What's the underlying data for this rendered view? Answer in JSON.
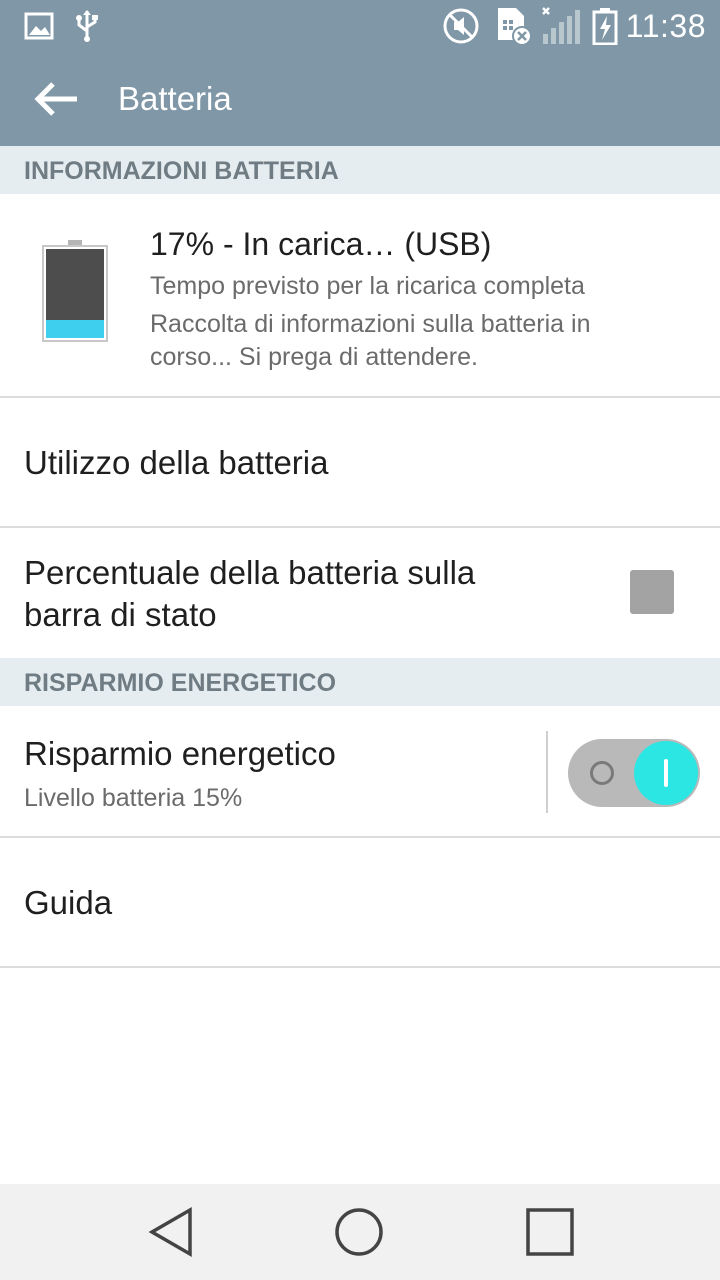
{
  "status_bar": {
    "time": "11:38",
    "icons": [
      "gallery-icon",
      "usb-icon",
      "mute-icon",
      "sim-error-icon",
      "signal-icon",
      "battery-charging-icon"
    ]
  },
  "app_bar": {
    "title": "Batteria"
  },
  "sections": {
    "battery_info_header": "INFORMAZIONI BATTERIA",
    "power_saving_header": "RISPARMIO ENERGETICO"
  },
  "battery": {
    "title": "17% - In carica… (USB)",
    "line1": "Tempo previsto per la ricarica completa",
    "line2": "Raccolta di informazioni sulla batteria in",
    "line3": "corso... Si prega di attendere.",
    "level_fraction": 0.2,
    "fill_color": "#3fcfee"
  },
  "items": {
    "usage": "Utilizzo della batteria",
    "percentage_line1": "Percentuale della batteria sulla",
    "percentage_line2": "barra di stato",
    "percentage_checked": false,
    "power_saving_title": "Risparmio energetico",
    "power_saving_sub": "Livello batteria 15%",
    "power_saving_on": true,
    "guide": "Guida"
  },
  "colors": {
    "header": "#7f97a6",
    "accent": "#2ce6e4",
    "section_bg": "#e6edf0"
  }
}
